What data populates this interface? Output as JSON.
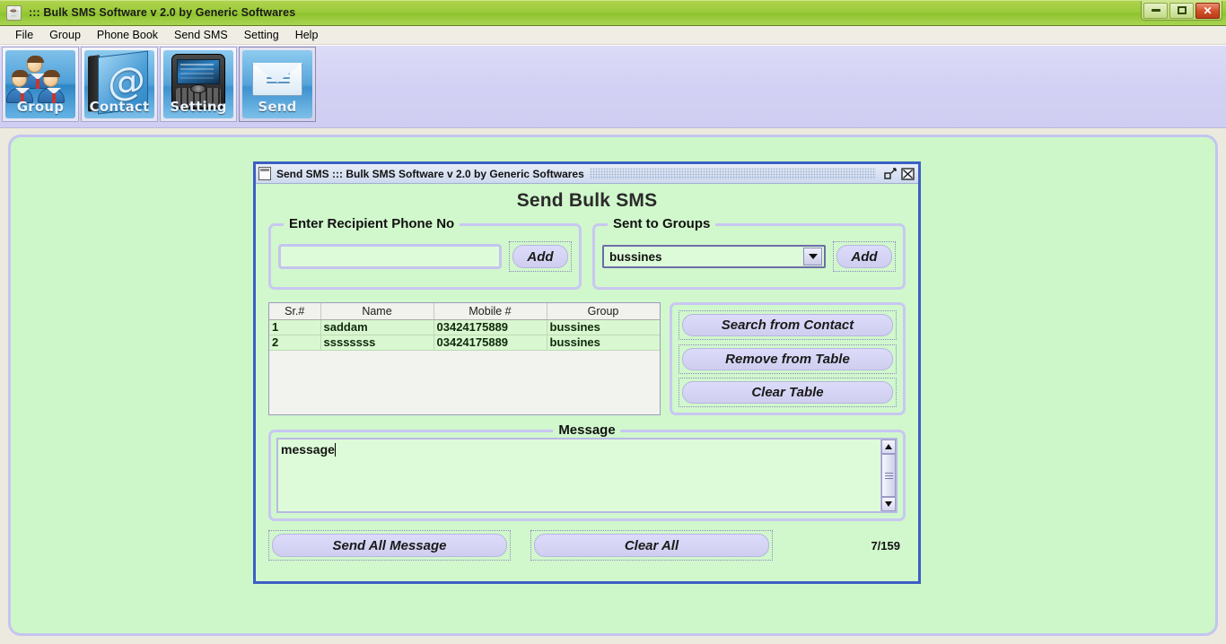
{
  "window": {
    "title": "::: Bulk SMS Software v 2.0 by Generic Softwares",
    "app_icon": "java-cup-icon",
    "controls": {
      "minimize": "minimize-icon",
      "maximize": "maximize-icon",
      "close": "✕"
    }
  },
  "menu": {
    "items": [
      {
        "label": "File"
      },
      {
        "label": "Group"
      },
      {
        "label": "Phone Book"
      },
      {
        "label": "Send SMS"
      },
      {
        "label": "Setting"
      },
      {
        "label": "Help"
      }
    ]
  },
  "toolbar": {
    "buttons": [
      {
        "label": "Group",
        "icon": "people-group-icon"
      },
      {
        "label": "Contact",
        "icon": "address-book-at-icon"
      },
      {
        "label": "Setting",
        "icon": "mobile-phone-icon"
      },
      {
        "label": "Send",
        "icon": "envelope-send-icon"
      }
    ]
  },
  "internal_frame": {
    "title": "Send SMS  ::: Bulk SMS Software v 2.0 by Generic Softwares",
    "icon": "window-icon",
    "restore_icon": "restore-icon",
    "close_icon": "close-icon",
    "heading": "Send Bulk SMS"
  },
  "recipient_panel": {
    "title": "Enter Recipient Phone No",
    "phone_value": "",
    "phone_placeholder": "",
    "add_label": "Add"
  },
  "groups_panel": {
    "title": "Sent to Groups",
    "selected_group": "bussines",
    "options": [
      "bussines"
    ],
    "add_label": "Add",
    "dropdown_icon": "chevron-down-icon"
  },
  "table": {
    "columns": [
      "Sr.#",
      "Name",
      "Mobile #",
      "Group"
    ],
    "rows": [
      {
        "sr": "1",
        "name": "saddam",
        "mobile": "03424175889",
        "group": "bussines"
      },
      {
        "sr": "2",
        "name": "ssssssss",
        "mobile": "03424175889",
        "group": "bussines"
      }
    ]
  },
  "side_buttons": {
    "search_from_contact": "Search from Contact",
    "remove_from_table": "Remove from Table",
    "clear_table": "Clear Table"
  },
  "message_panel": {
    "title": "Message",
    "text": "message",
    "scrollbar": {
      "up_icon": "scroll-up-icon",
      "down_icon": "scroll-down-icon"
    }
  },
  "bottom": {
    "send_all_label": "Send All Message",
    "clear_all_label": "Clear All",
    "char_counter": "7/159"
  },
  "colors": {
    "title_bar_green": "#9ccb3b",
    "toolbar_lavender": "#d2d1f4",
    "desktop_green": "#cdf7c8",
    "frame_border_blue": "#3c5fc4",
    "panel_border_lavender": "#c8c7f2",
    "button_lavender": "#d5d4f5",
    "table_row_green": "#d9f7d0",
    "close_red": "#cf4e28"
  }
}
